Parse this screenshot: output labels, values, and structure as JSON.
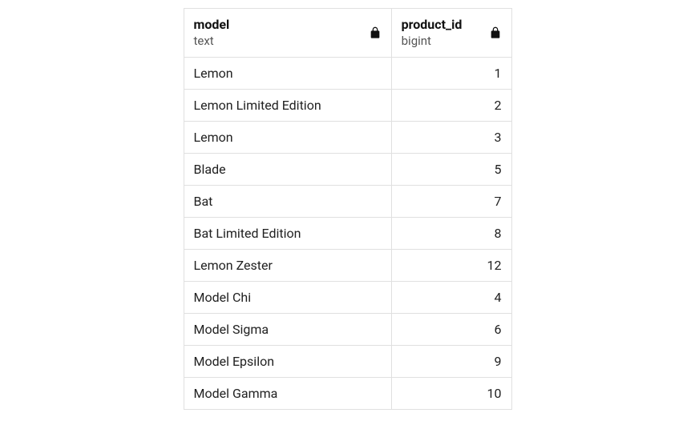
{
  "columns": [
    {
      "name": "model",
      "type": "text",
      "locked": true
    },
    {
      "name": "product_id",
      "type": "bigint",
      "locked": true
    }
  ],
  "rows": [
    {
      "model": "Lemon",
      "product_id": 1
    },
    {
      "model": "Lemon Limited Edition",
      "product_id": 2
    },
    {
      "model": "Lemon",
      "product_id": 3
    },
    {
      "model": "Blade",
      "product_id": 5
    },
    {
      "model": "Bat",
      "product_id": 7
    },
    {
      "model": "Bat Limited Edition",
      "product_id": 8
    },
    {
      "model": "Lemon Zester",
      "product_id": 12
    },
    {
      "model": "Model Chi",
      "product_id": 4
    },
    {
      "model": "Model Sigma",
      "product_id": 6
    },
    {
      "model": "Model Epsilon",
      "product_id": 9
    },
    {
      "model": "Model Gamma",
      "product_id": 10
    }
  ]
}
